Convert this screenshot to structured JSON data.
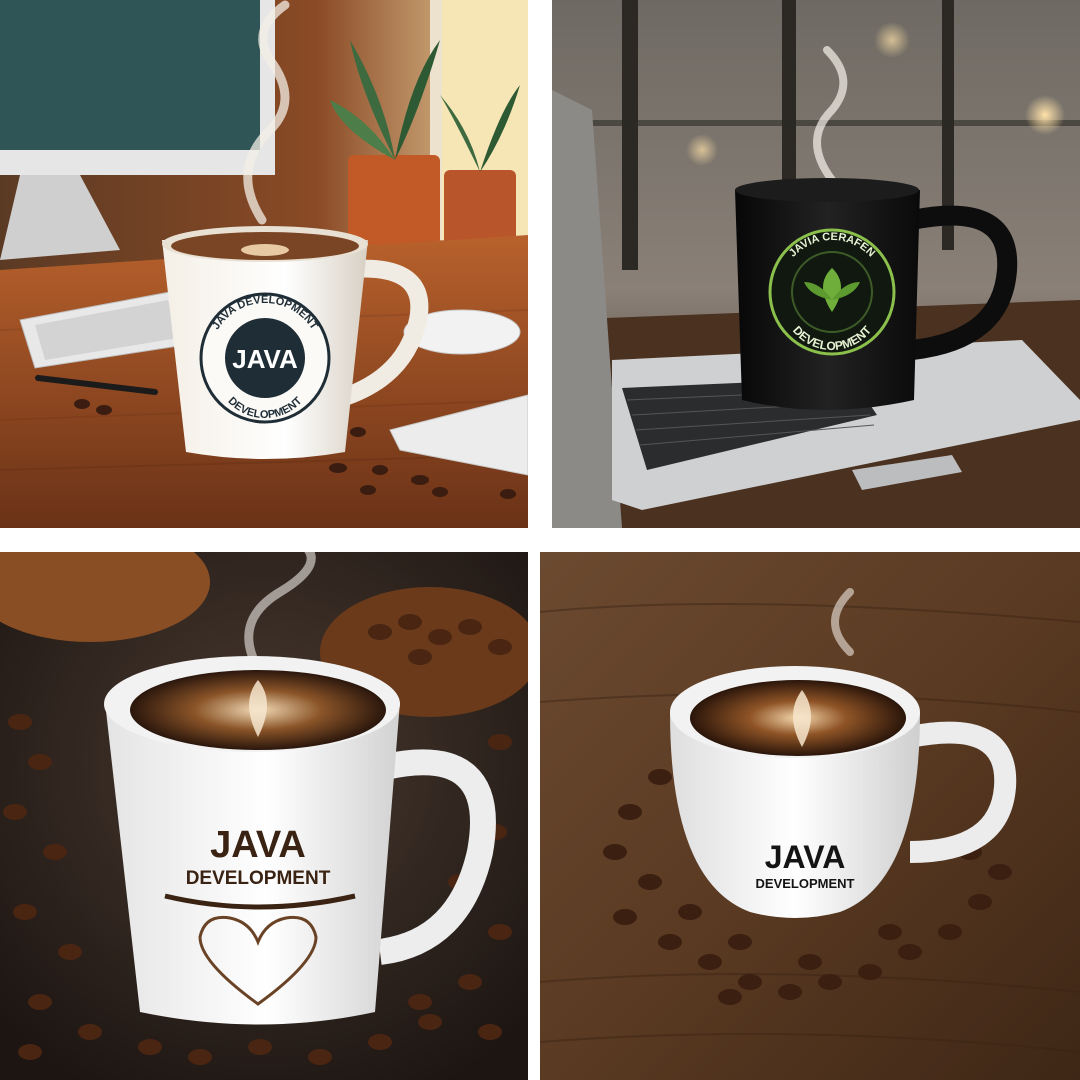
{
  "panels": [
    {
      "scene": "illustrated desk with monitor, keyboard, mouse and white mug",
      "mug": {
        "ring_top": "JAVA DEVELOPMENT",
        "ring_bottom": "DEVELOPMENT",
        "center": "JAVA"
      }
    },
    {
      "scene": "black mug on a laptop in a cafe",
      "mug": {
        "ring_top": "JAVIA CERAFEN",
        "ring_bottom": "DEVELOPMENT"
      }
    },
    {
      "scene": "white mug with latte art on coffee beans",
      "mug": {
        "line1": "JAVA",
        "line2": "DEVELOPMENT"
      }
    },
    {
      "scene": "white cup with latte art on wooden table",
      "mug": {
        "line1": "JAVA",
        "line2": "DEVELOPMENT"
      }
    }
  ],
  "colors": {
    "background": "#ffffff",
    "desk_wood": "#a0552a",
    "cafe_mug": "#151515",
    "badge_green": "#6fae3a",
    "coffee_brown": "#3b2214",
    "table_wood": "#5a3a22"
  }
}
